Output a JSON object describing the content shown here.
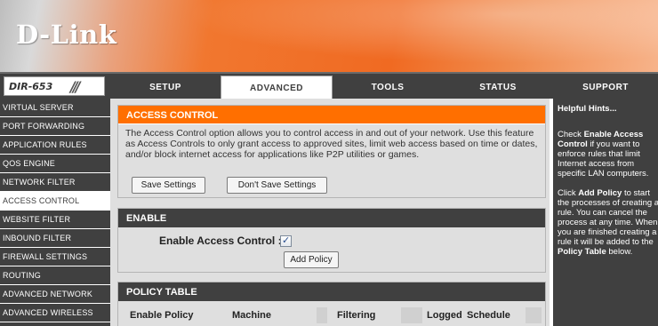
{
  "brand": {
    "logo_text": "D-Link",
    "model": "DIR-653"
  },
  "tabs": [
    {
      "label": "SETUP",
      "active": false
    },
    {
      "label": "ADVANCED",
      "active": true
    },
    {
      "label": "TOOLS",
      "active": false
    },
    {
      "label": "STATUS",
      "active": false
    },
    {
      "label": "SUPPORT",
      "active": false
    }
  ],
  "sidebar": {
    "items": [
      {
        "label": "VIRTUAL SERVER",
        "active": false
      },
      {
        "label": "PORT FORWARDING",
        "active": false
      },
      {
        "label": "APPLICATION RULES",
        "active": false
      },
      {
        "label": "QOS ENGINE",
        "active": false
      },
      {
        "label": "NETWORK FILTER",
        "active": false
      },
      {
        "label": "ACCESS CONTROL",
        "active": true
      },
      {
        "label": "WEBSITE FILTER",
        "active": false
      },
      {
        "label": "INBOUND FILTER",
        "active": false
      },
      {
        "label": "FIREWALL SETTINGS",
        "active": false
      },
      {
        "label": "ROUTING",
        "active": false
      },
      {
        "label": "ADVANCED NETWORK",
        "active": false
      },
      {
        "label": "ADVANCED WIRELESS",
        "active": false
      }
    ]
  },
  "access_control": {
    "title": "ACCESS CONTROL",
    "description": "The Access Control option allows you to control access in and out of your network. Use this feature as Access Controls to only grant access to approved sites, limit web access based on time or dates, and/or block internet access for applications like P2P utilities or games.",
    "save_label": "Save Settings",
    "dont_save_label": "Don't Save Settings"
  },
  "enable": {
    "title": "ENABLE",
    "label": "Enable Access Control :",
    "checked": true,
    "add_policy_label": "Add Policy"
  },
  "policy_table": {
    "title": "POLICY TABLE",
    "columns": [
      "Enable Policy",
      "Machine",
      "Filtering",
      "Logged",
      "Schedule"
    ]
  },
  "hints": {
    "title": "Helpful Hints...",
    "p1_pre": "Check ",
    "p1_bold": "Enable Access Control",
    "p1_post": " if you want to enforce rules that limit Internet access from specific LAN computers.",
    "p2_pre": "Click ",
    "p2_bold": "Add Policy",
    "p2_mid": " to start the processes of creating a rule. You can cancel the process at any time. When you are finished creating a rule it will be added to the ",
    "p2_bold2": "Policy Table",
    "p2_post": " below."
  },
  "colors": {
    "accent_orange": "#ff6f00",
    "dark_gray": "#404040",
    "panel_gray": "#dfdfdf"
  }
}
